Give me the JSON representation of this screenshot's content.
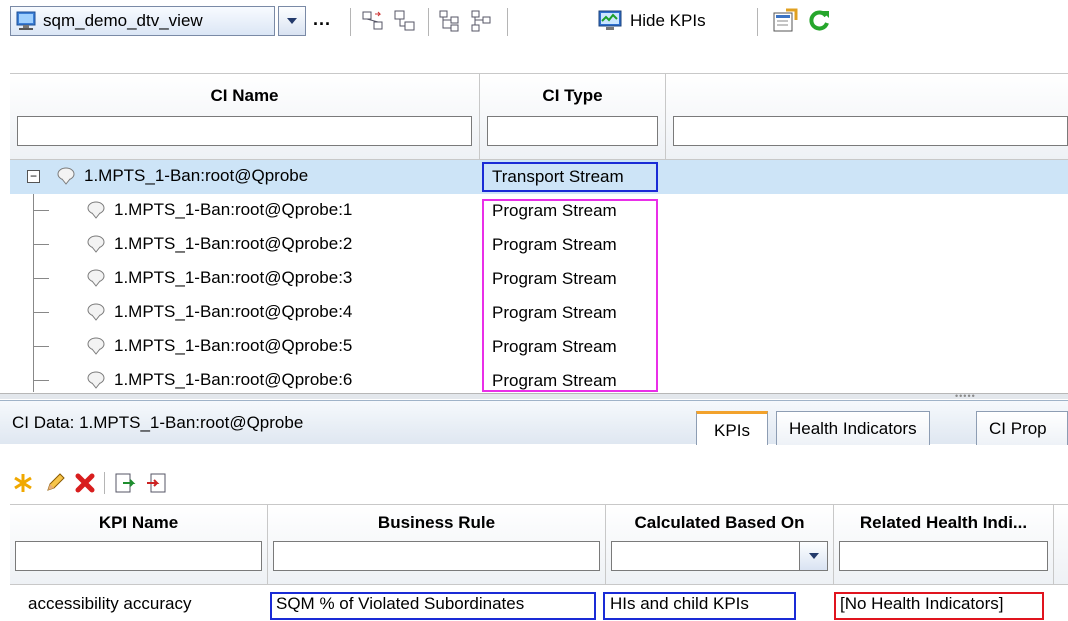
{
  "toolbar": {
    "view_name": "sqm_demo_dtv_view",
    "more_label": "...",
    "hide_kpis_label": "Hide KPIs"
  },
  "top_grid": {
    "columns": [
      "CI Name",
      "CI Type"
    ],
    "rows": [
      {
        "name": "1.MPTS_1-Ban:root@Qprobe",
        "type": "Transport Stream",
        "selected": true
      },
      {
        "name": "1.MPTS_1-Ban:root@Qprobe:1",
        "type": "Program Stream"
      },
      {
        "name": "1.MPTS_1-Ban:root@Qprobe:2",
        "type": "Program Stream"
      },
      {
        "name": "1.MPTS_1-Ban:root@Qprobe:3",
        "type": "Program Stream"
      },
      {
        "name": "1.MPTS_1-Ban:root@Qprobe:4",
        "type": "Program Stream"
      },
      {
        "name": "1.MPTS_1-Ban:root@Qprobe:5",
        "type": "Program Stream"
      },
      {
        "name": "1.MPTS_1-Ban:root@Qprobe:6",
        "type": "Program Stream"
      }
    ]
  },
  "ci_data": {
    "label": "CI Data: 1.MPTS_1-Ban:root@Qprobe",
    "tabs": [
      "KPIs",
      "Health Indicators",
      "CI Prop"
    ]
  },
  "kpi_grid": {
    "columns": [
      "KPI Name",
      "Business Rule",
      "Calculated Based On",
      "Related Health Indi..."
    ],
    "rows": [
      {
        "kpi_name": "accessibility accuracy",
        "business_rule": "SQM % of Violated Subordinates",
        "calculated_based_on": "HIs and child KPIs",
        "related_hi": "[No Health Indicators]"
      }
    ]
  },
  "colors": {
    "selected_row": "#cde4f7",
    "annotation_blue": "#1a2bd6",
    "annotation_magenta": "#e92fe8",
    "annotation_red": "#e0141e",
    "active_tab_accent": "#f2a22c"
  }
}
